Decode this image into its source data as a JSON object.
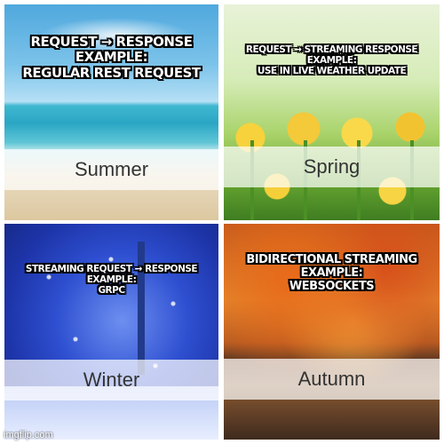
{
  "panels": {
    "summer": {
      "season": "Summer",
      "caption": [
        "REQUEST → RESPONSE",
        "EXAMPLE:",
        "REGULAR REST REQUEST"
      ]
    },
    "spring": {
      "season": "Spring",
      "caption": [
        "REQUEST → STREAMING RESPONSE",
        "EXAMPLE:",
        "USE IN LIVE WEATHER UPDATE"
      ]
    },
    "winter": {
      "season": "Winter",
      "caption": [
        "STREAMING REQUEST → RESPONSE",
        "EXAMPLE:",
        "GRPC"
      ]
    },
    "autumn": {
      "season": "Autumn",
      "caption": [
        "BIDIRECTIONAL STREAMING",
        "EXAMPLE:",
        "WEBSOCKETS"
      ]
    }
  },
  "watermark": "imgflip.com"
}
